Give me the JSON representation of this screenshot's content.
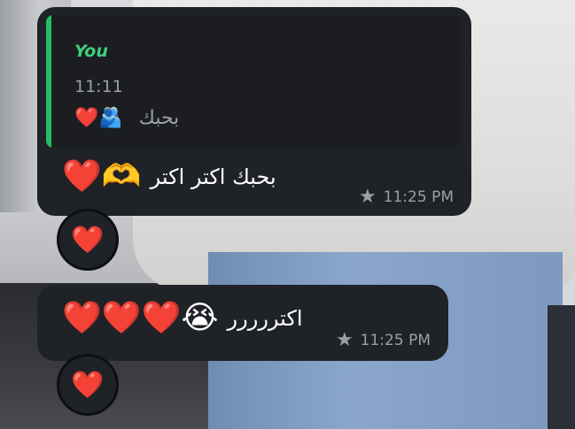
{
  "messages": [
    {
      "quote": {
        "author": "You",
        "time": "11:11",
        "emojis": "❤️🫂",
        "text": "بحبك"
      },
      "emojis": "❤️🫶",
      "text": "بحبك  اكتر   اكتر",
      "time": "11:25 PM",
      "starred": true,
      "reaction": "❤️"
    },
    {
      "emojis": "❤️❤️❤️😭",
      "text": "اكتررررر",
      "time": "11:25 PM",
      "starred": true,
      "reaction": "❤️"
    }
  ],
  "icons": {
    "star": "star-icon"
  },
  "colors": {
    "bubble": "#1f2226",
    "quote_accent": "#20c25e",
    "quote_author": "#3fd07a",
    "meta_text": "#9aa0a6"
  }
}
